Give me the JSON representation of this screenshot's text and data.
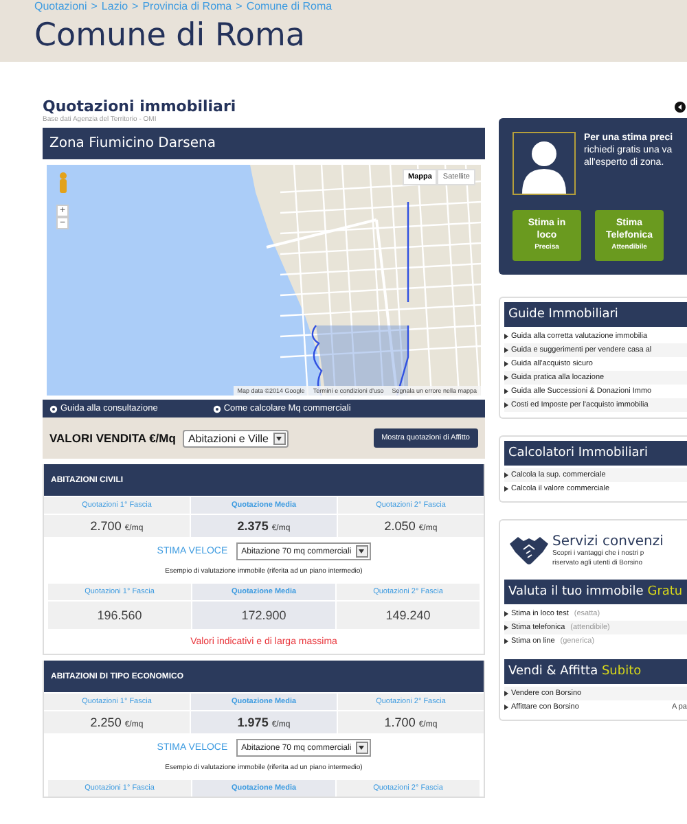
{
  "breadcrumb": {
    "items": [
      "Quotazioni",
      "Lazio",
      "Provincia di Roma",
      "Comune di Roma"
    ],
    "separator": ">"
  },
  "page_title": "Comune di Roma",
  "section": {
    "title": "Quotazioni immobiliari",
    "subtitle": "Base dati Agenzia del Territorio - OMI"
  },
  "zone": {
    "title": "Zona Fiumicino Darsena"
  },
  "map": {
    "zoom_in": "+",
    "zoom_out": "−",
    "types": [
      {
        "label": "Mappa",
        "selected": true
      },
      {
        "label": "Satellite",
        "selected": false
      }
    ],
    "attribution": [
      "Map data ©2014 Google",
      "Termini e condizioni d'uso",
      "Segnala un errore nella mappa"
    ]
  },
  "help_links": [
    "Guida alla consultazione",
    "Come calcolare Mq commerciali"
  ],
  "values_bar": {
    "label": "VALORI VENDITA €/Mq",
    "select": "Abitazioni e Ville",
    "button": "Mostra quotazioni di Affitto"
  },
  "categories": [
    {
      "title": "ABITAZIONI CIVILI",
      "columns": [
        {
          "label": "Quotazioni 1° Fascia",
          "emphasized": false
        },
        {
          "label": "Quotazione Media",
          "emphasized": true
        },
        {
          "label": "Quotazioni 2° Fascia",
          "emphasized": false
        }
      ],
      "prices": [
        {
          "amount": "2.700",
          "unit": "€/mq"
        },
        {
          "amount": "2.375",
          "unit": "€/mq"
        },
        {
          "amount": "2.050",
          "unit": "€/mq"
        }
      ],
      "quick_label": "STIMA VELOCE",
      "quick_select": "Abitazione 70 mq commerciali",
      "example_note": "Esempio di valutazione immobile (riferita ad un piano intermedio)",
      "estimate_columns": [
        {
          "label": "Quotazioni 1° Fascia",
          "emphasized": false
        },
        {
          "label": "Quotazione Media",
          "emphasized": true
        },
        {
          "label": "Quotazioni 2° Fascia",
          "emphasized": false
        }
      ],
      "estimates": [
        "196.560",
        "172.900",
        "149.240"
      ],
      "disclaimer": "Valori indicativi e di larga massima"
    },
    {
      "title": "ABITAZIONI DI TIPO ECONOMICO",
      "columns": [
        {
          "label": "Quotazioni 1° Fascia",
          "emphasized": false
        },
        {
          "label": "Quotazione Media",
          "emphasized": true
        },
        {
          "label": "Quotazioni 2° Fascia",
          "emphasized": false
        }
      ],
      "prices": [
        {
          "amount": "2.250",
          "unit": "€/mq"
        },
        {
          "amount": "1.975",
          "unit": "€/mq"
        },
        {
          "amount": "1.700",
          "unit": "€/mq"
        }
      ],
      "quick_label": "STIMA VELOCE",
      "quick_select": "Abitazione 70 mq commerciali",
      "example_note": "Esempio di valutazione immobile (riferita ad un piano intermedio)",
      "estimate_columns": [
        {
          "label": "Quotazioni 1° Fascia",
          "emphasized": false
        },
        {
          "label": "Quotazione Media",
          "emphasized": true
        },
        {
          "label": "Quotazioni 2° Fascia",
          "emphasized": false
        }
      ]
    }
  ],
  "expert": {
    "heading": "Per una stima preci",
    "lines": [
      "richiedi gratis una va",
      "all'esperto di zona."
    ],
    "buttons": [
      {
        "title": "Stima in loco",
        "subtitle": "Precisa"
      },
      {
        "title": "Stima Telefonica",
        "subtitle": "Attendibile"
      }
    ]
  },
  "guides": {
    "title": "Guide Immobiliari",
    "items": [
      "Guida alla corretta valutazione immobilia",
      "Guida e suggerimenti per vendere casa al",
      "Guida all'acquisto sicuro",
      "Guida pratica alla locazione",
      "Guida alle Successioni & Donazioni Immo",
      "Costi ed Imposte per l'acquisto immobilia"
    ]
  },
  "calculators": {
    "title": "Calcolatori Immobiliari",
    "items": [
      "Calcola la sup. commerciale",
      "Calcola il valore commerciale"
    ]
  },
  "services": {
    "title": "Servizi convenzi",
    "text": "Scopri i vantaggi che i nostri p riservato agli utenti di Borsino",
    "valuation": {
      "title": "Valuta il tuo immobile",
      "highlight": "Gratu",
      "items": [
        {
          "label": "Stima in loco test",
          "note": "(esatta)"
        },
        {
          "label": "Stima telefonica",
          "note": "(attendibile)"
        },
        {
          "label": "Stima on line",
          "note": "(generica)"
        }
      ]
    },
    "trade": {
      "title": "Vendi & Affitta",
      "highlight": "Subito",
      "items": [
        {
          "label": "Vendere con Borsino"
        },
        {
          "label": "Affittare con Borsino",
          "aside": "A pa"
        }
      ]
    }
  }
}
